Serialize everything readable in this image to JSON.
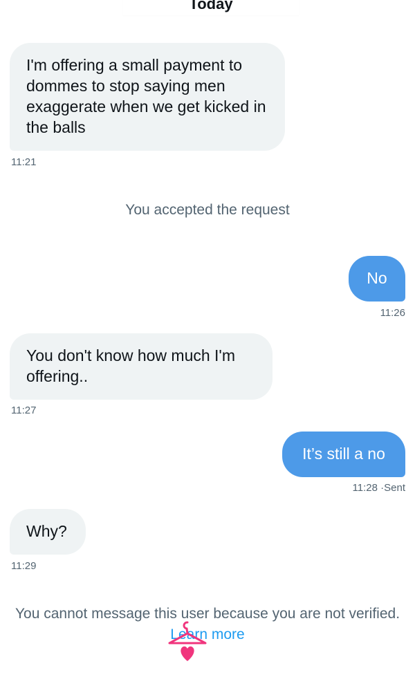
{
  "date_label": "Today",
  "messages": [
    {
      "direction": "in",
      "text": "I'm offering a small payment to dommes to stop saying men exaggerate when we get kicked in the balls",
      "time": "11:21"
    },
    {
      "direction": "out",
      "text": "No",
      "time": "11:26"
    },
    {
      "direction": "in",
      "text": "You don't know how much I'm offering..",
      "time": "11:27"
    },
    {
      "direction": "out",
      "text": "It’s still a no",
      "time": "11:28",
      "status": "Sent"
    },
    {
      "direction": "in",
      "text": "Why?",
      "time": "11:29"
    }
  ],
  "system_note": "You accepted the request",
  "footer": {
    "text": "You cannot message this user because you are not verified.",
    "link": "Learn more"
  },
  "colors": {
    "incoming_bubble": "#eff3f4",
    "outgoing_bubble": "#4d9ae8",
    "link": "#1d9bf0",
    "watermark": "#f0357d"
  },
  "watermark_icon": "pink-hanger-heart-logo"
}
